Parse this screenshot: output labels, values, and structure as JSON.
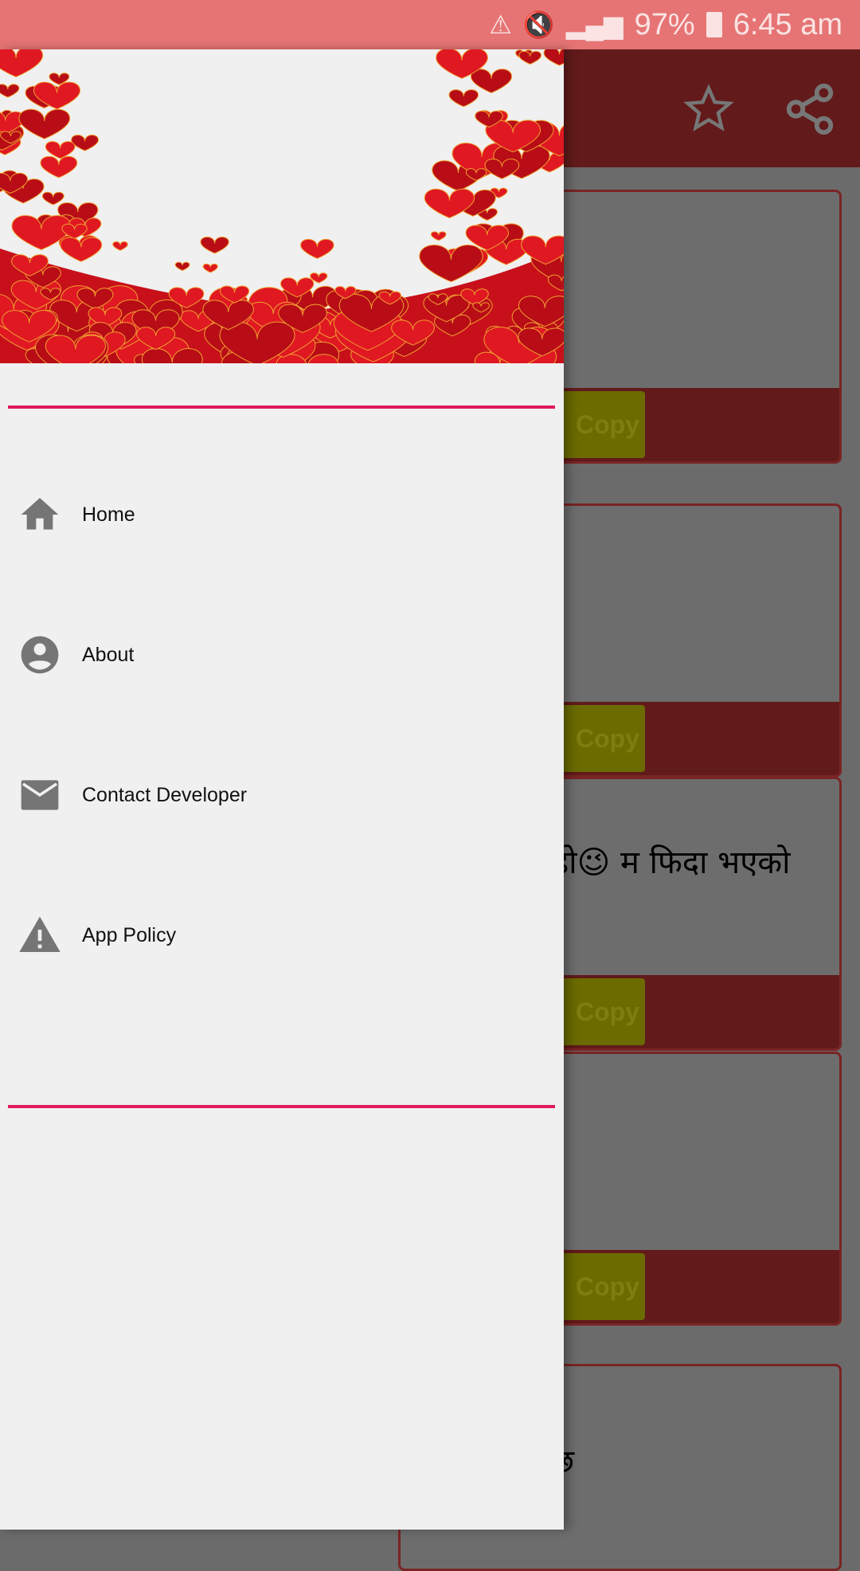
{
  "status_bar": {
    "battery": "97%",
    "time": "6:45 am",
    "icons": [
      "data-saver-icon",
      "vibrate-mute-icon",
      "signal-icon",
      "battery-icon"
    ]
  },
  "app_bar": {
    "actions": [
      "star-icon",
      "share-icon"
    ]
  },
  "cards": [
    {
      "text": "",
      "copy_label": "Copy"
    },
    {
      "text": "",
      "copy_label": "Copy"
    },
    {
      "text": "हो😉 म फिदा भएको",
      "copy_label": "Copy"
    },
    {
      "text": "",
      "copy_label": "Copy"
    },
    {
      "text": "छ",
      "copy_label": ""
    }
  ],
  "drawer": {
    "items": [
      {
        "label": "Home",
        "icon": "home-icon"
      },
      {
        "label": "About",
        "icon": "account-circle-icon"
      },
      {
        "label": "Contact Developer",
        "icon": "mail-icon"
      },
      {
        "label": "App Policy",
        "icon": "warning-icon"
      }
    ]
  },
  "colors": {
    "status_bar": "#e67474",
    "app_bar": "#621a1a",
    "divider": "#e0195a",
    "heart": "#d8141c"
  }
}
